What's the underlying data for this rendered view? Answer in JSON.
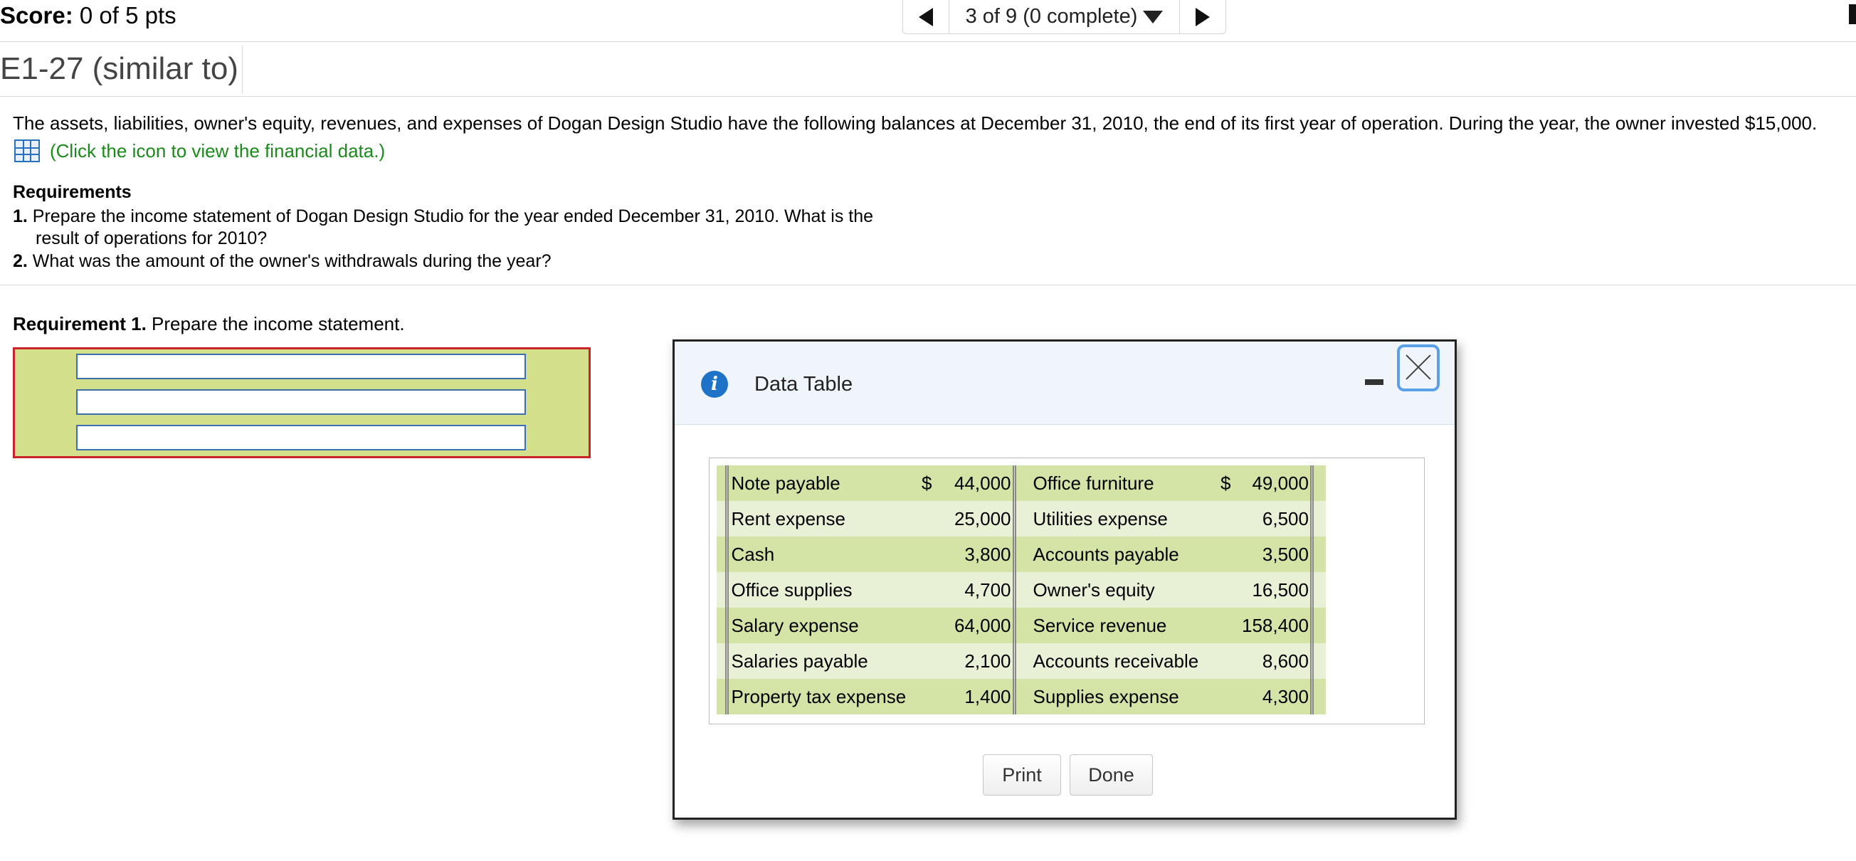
{
  "header": {
    "score_label": "Score:",
    "score_value": " 0 of 5 pts",
    "nav_position": "3 of 9 (0 complete)"
  },
  "question": {
    "title": "E1-27 (similar to)",
    "intro": "The assets, liabilities, owner's equity, revenues, and expenses of Dogan Design Studio have the following balances at December 31, 2010, the end of its first year of operation. During the year, the owner invested $15,000.",
    "data_link": "(Click the icon to view the financial data.)",
    "requirements_heading": "Requirements",
    "req1_num": "1.",
    "req1_line1": " Prepare the income statement of Dogan Design Studio for the year ended December 31, 2010.  What is the",
    "req1_line2": "result of operations for 2010?",
    "req2_num": "2.",
    "req2_text": " What was the amount of the owner's withdrawals during the year?",
    "part_label": "Requirement 1.",
    "part_text": " Prepare the income statement."
  },
  "modal": {
    "title": "Data Table",
    "print_label": "Print",
    "done_label": "Done",
    "rows": [
      {
        "left_label": "Note payable",
        "left_currency": "$",
        "left_amount": "44,000",
        "right_label": "Office furniture",
        "right_currency": "$",
        "right_amount": "49,000"
      },
      {
        "left_label": "Rent expense",
        "left_currency": "",
        "left_amount": "25,000",
        "right_label": "Utilities expense",
        "right_currency": "",
        "right_amount": "6,500"
      },
      {
        "left_label": "Cash",
        "left_currency": "",
        "left_amount": "3,800",
        "right_label": "Accounts payable",
        "right_currency": "",
        "right_amount": "3,500"
      },
      {
        "left_label": "Office supplies",
        "left_currency": "",
        "left_amount": "4,700",
        "right_label": "Owner's equity",
        "right_currency": "",
        "right_amount": "16,500"
      },
      {
        "left_label": "Salary expense",
        "left_currency": "",
        "left_amount": "64,000",
        "right_label": "Service revenue",
        "right_currency": "",
        "right_amount": "158,400"
      },
      {
        "left_label": "Salaries payable",
        "left_currency": "",
        "left_amount": "2,100",
        "right_label": "Accounts receivable",
        "right_currency": "",
        "right_amount": "8,600"
      },
      {
        "left_label": "Property tax expense",
        "left_currency": "",
        "left_amount": "1,400",
        "right_label": "Supplies expense",
        "right_currency": "",
        "right_amount": "4,300"
      }
    ]
  },
  "colors": {
    "answer_border": "#c8242a",
    "answer_fill": "#d3df8a",
    "link_green": "#1a8a1a",
    "info_blue": "#1e72c8"
  }
}
